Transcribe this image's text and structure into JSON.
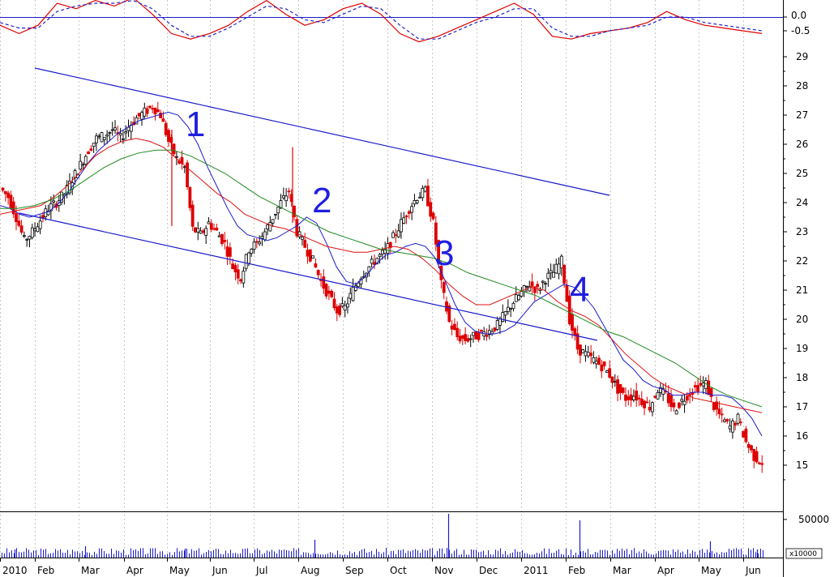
{
  "chart_data": [
    {
      "panel": "oscillator",
      "type": "line",
      "y_ticks": [
        "0.0",
        "-0.5"
      ],
      "ylim": [
        -1.3,
        1.3
      ],
      "zero_line": 0.0,
      "series": [
        {
          "color": "#dd0000",
          "style": "solid",
          "values": [
            -0.3,
            -0.6,
            -0.3,
            0.5,
            0.3,
            0.6,
            0.4,
            0.7,
            0.1,
            -0.6,
            -0.8,
            -0.6,
            -0.3,
            0.2,
            0.6,
            0.1,
            -0.3,
            -0.1,
            0.3,
            0.5,
            0.1,
            -0.6,
            -0.9,
            -0.7,
            -0.4,
            -0.1,
            0.2,
            0.5,
            0.1,
            -0.7,
            -0.8,
            -0.6,
            -0.5,
            -0.4,
            -0.2,
            0.2,
            -0.1,
            -0.3,
            -0.4,
            -0.5,
            -0.6
          ]
        },
        {
          "color": "#2222cc",
          "style": "dashed",
          "values": [
            -0.2,
            -0.4,
            -0.4,
            0.2,
            0.4,
            0.5,
            0.5,
            0.6,
            0.3,
            -0.3,
            -0.7,
            -0.7,
            -0.4,
            0.0,
            0.4,
            0.3,
            -0.1,
            -0.2,
            0.1,
            0.4,
            0.3,
            -0.3,
            -0.8,
            -0.8,
            -0.5,
            -0.2,
            0.0,
            0.3,
            0.3,
            -0.4,
            -0.7,
            -0.7,
            -0.5,
            -0.4,
            -0.3,
            0.0,
            0.0,
            -0.2,
            -0.3,
            -0.4,
            -0.5
          ]
        }
      ]
    },
    {
      "panel": "price",
      "type": "candlestick",
      "y_ticks": [
        29,
        28,
        27,
        26,
        25,
        24,
        23,
        22,
        21,
        20,
        19,
        18,
        17,
        16,
        15
      ],
      "x_tick_labels": [
        "2010",
        "Feb",
        "Mar",
        "Apr",
        "May",
        "Jun",
        "Jul",
        "Aug",
        "Sep",
        "Oct",
        "Nov",
        "Dec",
        "2011",
        "Feb",
        "Mar",
        "Apr",
        "May",
        "Jun"
      ],
      "annotations": [
        "1",
        "2",
        "3",
        "4"
      ],
      "close_path": [
        24.5,
        24.2,
        23.5,
        22.7,
        23.0,
        23.4,
        23.8,
        24.0,
        24.3,
        24.8,
        25.3,
        25.8,
        26.2,
        26.3,
        26.5,
        26.2,
        26.6,
        26.9,
        27.1,
        27.3,
        27.0,
        26.1,
        25.5,
        25.2,
        23.1,
        22.9,
        23.3,
        23.0,
        22.6,
        21.8,
        21.4,
        22.4,
        22.6,
        23.0,
        23.5,
        24.0,
        24.4,
        23.0,
        22.5,
        22.0,
        21.3,
        20.8,
        20.3,
        20.4,
        21.0,
        21.5,
        21.8,
        22.1,
        22.3,
        22.8,
        23.3,
        23.8,
        24.2,
        24.4,
        23.3,
        21.2,
        19.9,
        19.4,
        19.3,
        19.4,
        19.5,
        19.6,
        19.8,
        20.2,
        20.6,
        20.9,
        21.2,
        21.0,
        21.4,
        21.6,
        22.0,
        20.0,
        19.0,
        18.8,
        18.6,
        18.4,
        18.1,
        17.6,
        17.3,
        17.4,
        17.2,
        17.0,
        17.6,
        17.4,
        16.9,
        17.2,
        17.5,
        17.7,
        17.8,
        17.0,
        16.6,
        16.3,
        16.6,
        15.8,
        15.3,
        15.1
      ],
      "series": [
        {
          "color": "#1a1acc",
          "values": [
            23.9,
            23.8,
            23.6,
            23.5,
            23.6,
            23.7,
            24.0,
            24.4,
            24.9,
            25.4,
            25.8,
            26.1,
            26.4,
            26.6,
            26.8,
            26.9,
            27.0,
            27.1,
            27.0,
            26.6,
            26.0,
            25.2,
            24.5,
            23.8,
            23.2,
            22.9,
            22.8,
            22.7,
            22.8,
            23.0,
            23.2,
            23.5,
            23.3,
            22.6,
            21.8,
            21.3,
            21.2,
            21.5,
            21.9,
            22.2,
            22.3,
            22.5,
            22.6,
            22.5,
            22.1,
            21.3,
            20.5,
            19.9,
            19.6,
            19.5,
            19.5,
            19.6,
            19.8,
            20.2,
            20.6,
            20.8,
            21.0,
            21.2,
            21.1,
            20.8,
            20.4,
            19.8,
            19.2,
            18.6,
            18.3,
            17.9,
            17.7,
            17.6,
            17.4,
            17.4,
            17.5,
            17.5,
            17.4,
            17.4,
            17.3,
            17.0,
            16.6,
            16.0
          ]
        },
        {
          "color": "#dd1111",
          "values": [
            23.6,
            23.7,
            23.8,
            23.9,
            24.2,
            24.6,
            25.1,
            25.6,
            25.9,
            26.1,
            26.2,
            26.1,
            25.9,
            25.5,
            25.1,
            24.7,
            24.3,
            24.0,
            23.6,
            23.4,
            23.2,
            23.1,
            22.9,
            22.7,
            22.5,
            22.4,
            22.3,
            22.3,
            22.4,
            22.5,
            22.4,
            22.1,
            21.7,
            21.2,
            20.8,
            20.5,
            20.5,
            20.7,
            20.9,
            21.1,
            21.0,
            20.6,
            20.3,
            20.1,
            19.8,
            19.3,
            18.8,
            18.4,
            18.0,
            17.7,
            17.5,
            17.3,
            17.2,
            17.1,
            17.0,
            16.9,
            16.8
          ]
        },
        {
          "color": "#1f8a1f",
          "values": [
            23.8,
            23.8,
            23.9,
            24.1,
            24.4,
            24.8,
            25.2,
            25.5,
            25.7,
            25.8,
            25.8,
            25.6,
            25.3,
            25.0,
            24.6,
            24.2,
            23.9,
            23.6,
            23.3,
            23.0,
            22.8,
            22.6,
            22.4,
            22.3,
            22.2,
            22.1,
            21.9,
            21.6,
            21.4,
            21.2,
            21.0,
            20.8,
            20.5,
            20.2,
            19.9,
            19.6,
            19.4,
            19.1,
            18.8,
            18.5,
            18.1,
            17.7,
            17.4,
            17.2,
            17.0
          ]
        }
      ],
      "channel_lines": [
        {
          "color": "#1a1acc",
          "from": [
            "2010-Feb",
            28.5
          ],
          "to": [
            "2011-Mar",
            23.2
          ]
        },
        {
          "color": "#1a1acc",
          "from": [
            "2010-Feb",
            22.5
          ],
          "to": [
            "2011-Mar",
            18.4
          ]
        }
      ]
    },
    {
      "panel": "volume",
      "type": "bar",
      "y_ticks": [
        "50000"
      ],
      "unit_label": "x10000",
      "spikes": [
        1.0,
        0.85
      ]
    }
  ]
}
